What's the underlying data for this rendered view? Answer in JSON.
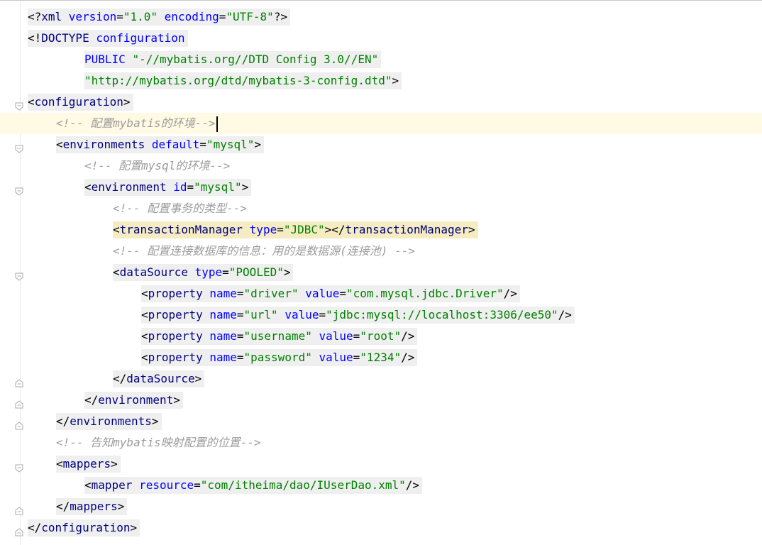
{
  "editor": {
    "lines": [
      {
        "indent": 0,
        "fold": "",
        "segments": [
          {
            "c": "t-pi",
            "t": "<?"
          },
          {
            "c": "t-tag",
            "t": "xml "
          },
          {
            "c": "t-attr",
            "t": "version"
          },
          {
            "c": "t-eq",
            "t": "="
          },
          {
            "c": "t-val",
            "t": "\"1.0\" "
          },
          {
            "c": "t-attr",
            "t": "encoding"
          },
          {
            "c": "t-eq",
            "t": "="
          },
          {
            "c": "t-val",
            "t": "\"UTF-8\""
          },
          {
            "c": "t-pi",
            "t": "?>"
          }
        ]
      },
      {
        "indent": 0,
        "fold": "",
        "segments": [
          {
            "c": "t-br",
            "t": "<!"
          },
          {
            "c": "t-tag",
            "t": "DOCTYPE "
          },
          {
            "c": "t-attr",
            "t": "configuration"
          }
        ]
      },
      {
        "indent": 2,
        "fold": "",
        "segments": [
          {
            "c": "t-attr",
            "t": "PUBLIC "
          },
          {
            "c": "t-val",
            "t": "\"-//mybatis.org//DTD Config 3.0//EN\""
          }
        ]
      },
      {
        "indent": 2,
        "fold": "",
        "segments": [
          {
            "c": "t-val",
            "t": "\"http://mybatis.org/dtd/mybatis-3-config.dtd\""
          },
          {
            "c": "t-br",
            "t": ">"
          }
        ]
      },
      {
        "indent": 0,
        "fold": "open",
        "bulb": true,
        "segments": [
          {
            "c": "t-br",
            "t": "<"
          },
          {
            "c": "t-tag",
            "t": "configuration"
          },
          {
            "c": "t-br",
            "t": ">"
          }
        ]
      },
      {
        "indent": 1,
        "fold": "",
        "comment": true,
        "current": true,
        "caret": true,
        "segments": [
          {
            "c": "comment-seg",
            "t": "<!-- 配置mybatis的环境-->"
          }
        ]
      },
      {
        "indent": 1,
        "fold": "open",
        "segments": [
          {
            "c": "t-br",
            "t": "<"
          },
          {
            "c": "t-tag",
            "t": "environments "
          },
          {
            "c": "t-attr",
            "t": "default"
          },
          {
            "c": "t-eq",
            "t": "="
          },
          {
            "c": "t-val",
            "t": "\"mysql\""
          },
          {
            "c": "t-br",
            "t": ">"
          }
        ]
      },
      {
        "indent": 2,
        "fold": "",
        "comment": true,
        "segments": [
          {
            "c": "comment-seg",
            "t": "<!-- 配置mysql的环境-->"
          }
        ]
      },
      {
        "indent": 2,
        "fold": "open",
        "segments": [
          {
            "c": "t-br",
            "t": "<"
          },
          {
            "c": "t-tag",
            "t": "environment "
          },
          {
            "c": "t-attr",
            "t": "id"
          },
          {
            "c": "t-eq",
            "t": "="
          },
          {
            "c": "t-val",
            "t": "\"mysql\""
          },
          {
            "c": "t-br",
            "t": ">"
          }
        ]
      },
      {
        "indent": 3,
        "fold": "",
        "comment": true,
        "segments": [
          {
            "c": "comment-seg",
            "t": "<!-- 配置事务的类型-->"
          }
        ]
      },
      {
        "indent": 3,
        "fold": "",
        "matched": true,
        "segments": [
          {
            "c": "t-br",
            "t": "<"
          },
          {
            "c": "t-tag",
            "t": "transactionManager "
          },
          {
            "c": "t-attr",
            "t": "type"
          },
          {
            "c": "t-eq",
            "t": "="
          },
          {
            "c": "t-val",
            "t": "\"JDBC\""
          },
          {
            "c": "t-br",
            "t": "></"
          },
          {
            "c": "t-tag",
            "t": "transactionManager"
          },
          {
            "c": "t-br",
            "t": ">"
          }
        ]
      },
      {
        "indent": 3,
        "fold": "",
        "comment": true,
        "segments": [
          {
            "c": "comment-seg",
            "t": "<!-- 配置连接数据库的信息：用的是数据源(连接池) -->"
          }
        ]
      },
      {
        "indent": 3,
        "fold": "open",
        "segments": [
          {
            "c": "t-br",
            "t": "<"
          },
          {
            "c": "t-tag",
            "t": "dataSource "
          },
          {
            "c": "t-attr",
            "t": "type"
          },
          {
            "c": "t-eq",
            "t": "="
          },
          {
            "c": "t-val",
            "t": "\"POOLED\""
          },
          {
            "c": "t-br",
            "t": ">"
          }
        ]
      },
      {
        "indent": 4,
        "fold": "",
        "segments": [
          {
            "c": "t-br",
            "t": "<"
          },
          {
            "c": "t-tag",
            "t": "property "
          },
          {
            "c": "t-attr",
            "t": "name"
          },
          {
            "c": "t-eq",
            "t": "="
          },
          {
            "c": "t-val",
            "t": "\"driver\" "
          },
          {
            "c": "t-attr",
            "t": "value"
          },
          {
            "c": "t-eq",
            "t": "="
          },
          {
            "c": "t-val",
            "t": "\"com.mysql.jdbc.Driver\""
          },
          {
            "c": "t-br",
            "t": "/>"
          }
        ]
      },
      {
        "indent": 4,
        "fold": "",
        "segments": [
          {
            "c": "t-br",
            "t": "<"
          },
          {
            "c": "t-tag",
            "t": "property "
          },
          {
            "c": "t-attr",
            "t": "name"
          },
          {
            "c": "t-eq",
            "t": "="
          },
          {
            "c": "t-val",
            "t": "\"url\" "
          },
          {
            "c": "t-attr",
            "t": "value"
          },
          {
            "c": "t-eq",
            "t": "="
          },
          {
            "c": "t-val",
            "t": "\"jdbc:mysql://localhost:3306/ee50\""
          },
          {
            "c": "t-br",
            "t": "/>"
          }
        ]
      },
      {
        "indent": 4,
        "fold": "",
        "segments": [
          {
            "c": "t-br",
            "t": "<"
          },
          {
            "c": "t-tag",
            "t": "property "
          },
          {
            "c": "t-attr",
            "t": "name"
          },
          {
            "c": "t-eq",
            "t": "="
          },
          {
            "c": "t-val",
            "t": "\"username\" "
          },
          {
            "c": "t-attr",
            "t": "value"
          },
          {
            "c": "t-eq",
            "t": "="
          },
          {
            "c": "t-val",
            "t": "\"root\""
          },
          {
            "c": "t-br",
            "t": "/>"
          }
        ]
      },
      {
        "indent": 4,
        "fold": "",
        "segments": [
          {
            "c": "t-br",
            "t": "<"
          },
          {
            "c": "t-tag",
            "t": "property "
          },
          {
            "c": "t-attr",
            "t": "name"
          },
          {
            "c": "t-eq",
            "t": "="
          },
          {
            "c": "t-val",
            "t": "\"password\" "
          },
          {
            "c": "t-attr",
            "t": "value"
          },
          {
            "c": "t-eq",
            "t": "="
          },
          {
            "c": "t-val",
            "t": "\"1234\""
          },
          {
            "c": "t-br",
            "t": "/>"
          }
        ]
      },
      {
        "indent": 3,
        "fold": "close",
        "segments": [
          {
            "c": "t-br",
            "t": "</"
          },
          {
            "c": "t-tag",
            "t": "dataSource"
          },
          {
            "c": "t-br",
            "t": ">"
          }
        ]
      },
      {
        "indent": 2,
        "fold": "close",
        "segments": [
          {
            "c": "t-br",
            "t": "</"
          },
          {
            "c": "t-tag",
            "t": "environment"
          },
          {
            "c": "t-br",
            "t": ">"
          }
        ]
      },
      {
        "indent": 1,
        "fold": "close",
        "segments": [
          {
            "c": "t-br",
            "t": "</"
          },
          {
            "c": "t-tag",
            "t": "environments"
          },
          {
            "c": "t-br",
            "t": ">"
          }
        ]
      },
      {
        "indent": 1,
        "fold": "",
        "comment": true,
        "segments": [
          {
            "c": "comment-seg",
            "t": "<!-- 告知mybatis映射配置的位置-->"
          }
        ]
      },
      {
        "indent": 1,
        "fold": "open",
        "segments": [
          {
            "c": "t-br",
            "t": "<"
          },
          {
            "c": "t-tag",
            "t": "mappers"
          },
          {
            "c": "t-br",
            "t": ">"
          }
        ]
      },
      {
        "indent": 2,
        "fold": "",
        "segments": [
          {
            "c": "t-br",
            "t": "<"
          },
          {
            "c": "t-tag",
            "t": "mapper "
          },
          {
            "c": "t-attr",
            "t": "resource"
          },
          {
            "c": "t-eq",
            "t": "="
          },
          {
            "c": "t-val",
            "t": "\"com/itheima/dao/IUserDao.xml\""
          },
          {
            "c": "t-br",
            "t": "/>"
          }
        ]
      },
      {
        "indent": 1,
        "fold": "close",
        "segments": [
          {
            "c": "t-br",
            "t": "</"
          },
          {
            "c": "t-tag",
            "t": "mappers"
          },
          {
            "c": "t-br",
            "t": ">"
          }
        ]
      },
      {
        "indent": 0,
        "fold": "close",
        "segments": [
          {
            "c": "t-br",
            "t": "</"
          },
          {
            "c": "t-tag",
            "t": "configuration"
          },
          {
            "c": "t-br",
            "t": ">"
          }
        ]
      }
    ]
  }
}
